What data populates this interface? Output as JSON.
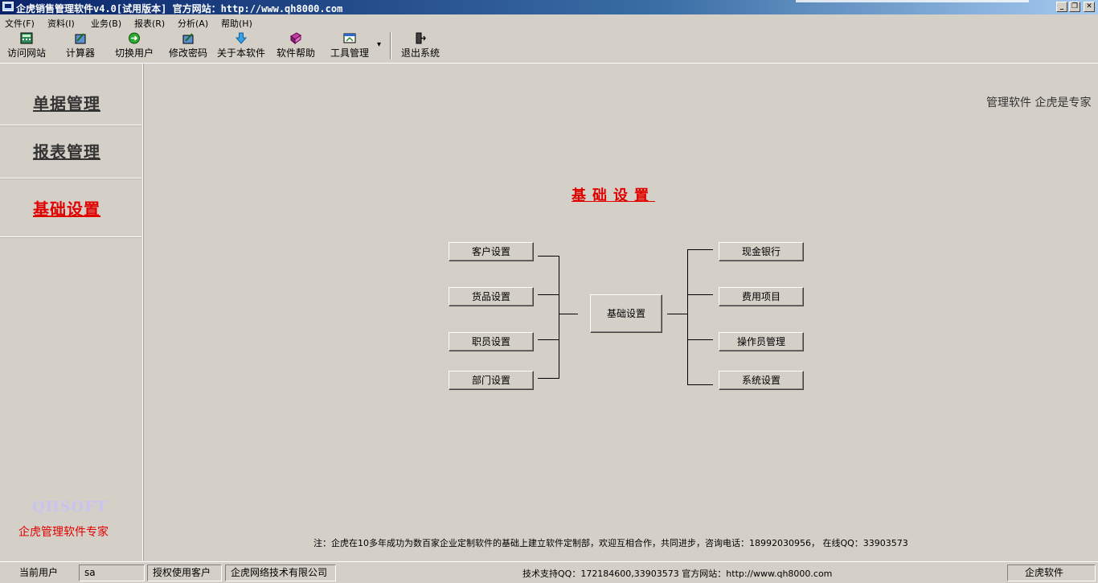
{
  "window": {
    "title": "企虎销售管理软件v4.0[试用版本] 官方网站：http://www.qh8000.com",
    "minimize_glyph": "_",
    "maximize_glyph": "❐",
    "close_glyph": "✕"
  },
  "menu": [
    "文件(F)",
    "资料(I)",
    "业务(B)",
    "报表(R)",
    "分析(A)",
    "帮助(H)"
  ],
  "toolbar": {
    "items": [
      {
        "label": "访问网站",
        "icon": "calculator-globe-icon"
      },
      {
        "label": "计算器",
        "icon": "calculator-icon"
      },
      {
        "label": "切换用户",
        "icon": "switch-user-icon"
      },
      {
        "label": "修改密码",
        "icon": "edit-password-icon"
      },
      {
        "label": "关于本软件",
        "icon": "about-icon"
      },
      {
        "label": "软件帮助",
        "icon": "help-book-icon"
      },
      {
        "label": "工具管理",
        "icon": "tools-icon"
      },
      {
        "label": "退出系统",
        "icon": "exit-icon"
      }
    ],
    "dropdown_glyph": "▾"
  },
  "sidebar": {
    "items": [
      {
        "label": "单据管理",
        "active": false
      },
      {
        "label": "报表管理",
        "active": false
      },
      {
        "label": "基础设置",
        "active": true
      }
    ],
    "brand": "QHSOFT",
    "slogan": "企虎管理软件专家"
  },
  "main": {
    "tagline": "管理软件  企虎是专家",
    "section_title": "基础设置",
    "center_button": "基础设置",
    "left_buttons": [
      "客户设置",
      "货品设置",
      "职员设置",
      "部门设置"
    ],
    "right_buttons": [
      "现金银行",
      "费用项目",
      "操作员管理",
      "系统设置"
    ],
    "note": "注：企虎在10多年成功为数百家企业定制软件的基础上建立软件定制部，欢迎互相合作，共同进步，咨询电话：18992030956，  在线QQ：33903573"
  },
  "status": {
    "current_user_label": "当前用户",
    "current_user": "sa",
    "licensed_label": "授权使用客户",
    "licensed_company": "企虎网络技术有限公司",
    "support": "技术支持QQ：172184600,33903573 官方网站：http://www.qh8000.com",
    "brand": "企虎软件"
  },
  "colors": {
    "accent_red": "#e00000",
    "titlebar": "#0a246a",
    "background": "#d4d0c8"
  }
}
